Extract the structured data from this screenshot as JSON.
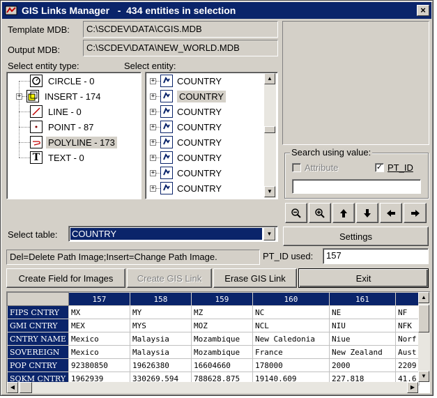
{
  "window": {
    "title": "GIS Links Manager   -  434 entities in selection",
    "close_glyph": "×"
  },
  "template_mdb": {
    "label": "Template MDB:",
    "value": "C:\\SCDEV\\DATA\\CGIS.MDB"
  },
  "output_mdb": {
    "label": "Output MDB:",
    "value": "C:\\SCDEV\\DATA\\NEW_WORLD.MDB"
  },
  "entity_types": {
    "label": "Select entity type:",
    "items": [
      {
        "label": "CIRCLE - 0",
        "icon": "circle-icon",
        "expandable": false,
        "selected": false
      },
      {
        "label": "INSERT - 174",
        "icon": "insert-icon",
        "expandable": true,
        "selected": false
      },
      {
        "label": "LINE - 0",
        "icon": "line-icon",
        "expandable": false,
        "selected": false
      },
      {
        "label": "POINT - 87",
        "icon": "point-icon",
        "expandable": false,
        "selected": false
      },
      {
        "label": "POLYLINE - 173",
        "icon": "polyline-icon",
        "expandable": false,
        "selected": true
      },
      {
        "label": "TEXT - 0",
        "icon": "text-icon",
        "expandable": false,
        "selected": false
      }
    ]
  },
  "entities": {
    "label": "Select entity:",
    "items": [
      {
        "label": "COUNTRY",
        "selected": false
      },
      {
        "label": "COUNTRY",
        "selected": true
      },
      {
        "label": "COUNTRY",
        "selected": false
      },
      {
        "label": "COUNTRY",
        "selected": false
      },
      {
        "label": "COUNTRY",
        "selected": false
      },
      {
        "label": "COUNTRY",
        "selected": false
      },
      {
        "label": "COUNTRY",
        "selected": false
      },
      {
        "label": "COUNTRY",
        "selected": false
      }
    ]
  },
  "search": {
    "title": "Search using value:",
    "attribute_label": "Attribute",
    "attribute_checked": false,
    "pt_id_label": "PT_ID",
    "pt_id_checked": true,
    "value": ""
  },
  "nav_buttons": [
    "zoom-out-icon",
    "zoom-in-icon",
    "arrow-up-icon",
    "arrow-down-icon",
    "arrow-left-icon",
    "arrow-right-icon"
  ],
  "settings_label": "Settings",
  "select_table": {
    "label": "Select table:",
    "value": "COUNTRY"
  },
  "hint": "Del=Delete Path Image;Insert=Change Path Image.",
  "pt_id_used": {
    "label": "PT_ID used:",
    "value": "157"
  },
  "actions": {
    "create_field": "Create Field for Images",
    "create_link": "Create GIS Link",
    "erase_link": "Erase GIS Link",
    "exit": "Exit"
  },
  "grid": {
    "columns": [
      "157",
      "158",
      "159",
      "160",
      "161",
      ""
    ],
    "rows": [
      {
        "header": "FIPS CNTRY",
        "cells": [
          "MX",
          "MY",
          "MZ",
          "NC",
          "NE",
          "NF"
        ]
      },
      {
        "header": "GMI CNTRY",
        "cells": [
          "MEX",
          "MYS",
          "MOZ",
          "NCL",
          "NIU",
          "NFK"
        ]
      },
      {
        "header": "CNTRY NAME",
        "cells": [
          "Mexico",
          "Malaysia",
          "Mozambique",
          "New Caledonia",
          "Niue",
          "Norf"
        ]
      },
      {
        "header": "SOVEREIGN",
        "cells": [
          "Mexico",
          "Malaysia",
          "Mozambique",
          "France",
          "New Zealand",
          "Aust"
        ]
      },
      {
        "header": "POP CNTRY",
        "cells": [
          "92380850",
          "19626380",
          "16604660",
          "178000",
          "2000",
          "2209"
        ]
      },
      {
        "header": "SQKM CNTRY",
        "cells": [
          "1962939",
          "330269.594",
          "788628.875",
          "19140.609",
          "227.818",
          "41.6"
        ]
      }
    ]
  },
  "colors": {
    "titlebar": "#0a246a",
    "face": "#d4d0c8",
    "selection": "#0a246a"
  }
}
